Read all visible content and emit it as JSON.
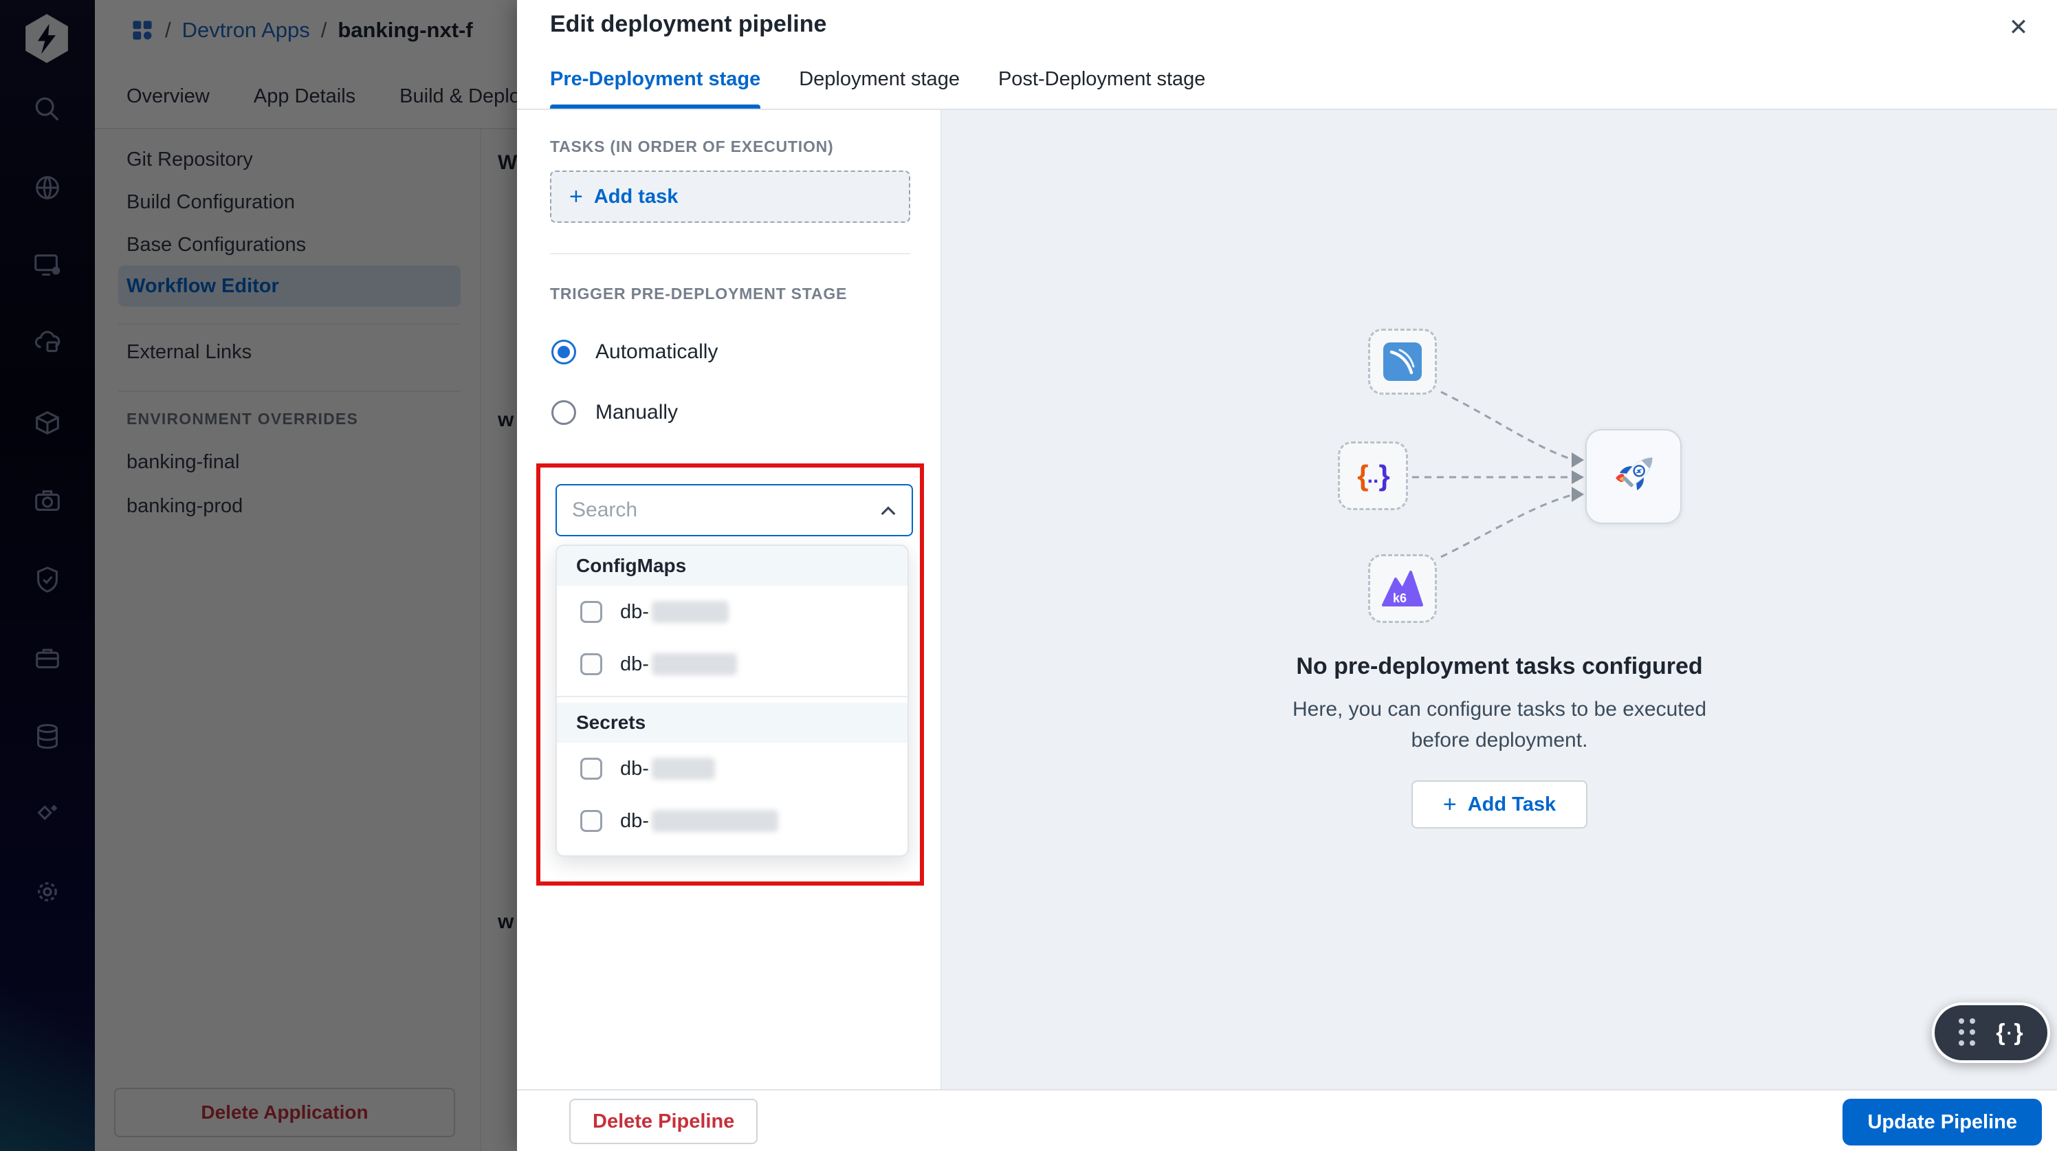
{
  "app": {
    "breadcrumb": {
      "sep": "/",
      "items": [
        "Devtron Apps",
        "banking-nxt-f"
      ]
    },
    "tabs": [
      "Overview",
      "App Details",
      "Build & Deploy"
    ],
    "sidebar": {
      "items": [
        "Git Repository",
        "Build Configuration",
        "Base Configurations",
        "Workflow Editor",
        "External Links"
      ],
      "active_item": "Workflow Editor",
      "section_label": "ENVIRONMENT OVERRIDES",
      "environments": [
        "banking-final",
        "banking-prod"
      ],
      "delete_button": "Delete Application"
    },
    "fragments": [
      "W",
      "w",
      "w"
    ],
    "rail_icons": [
      "devtron-logo",
      "search-icon",
      "globe-icon",
      "monitor-icon",
      "cloud-ci-icon",
      "package-icon",
      "camera-icon",
      "shield-check-icon",
      "briefcase-icon",
      "database-icon",
      "sparkle-icon",
      "gear-icon"
    ]
  },
  "modal": {
    "title": "Edit deployment pipeline",
    "close_icon": "✕",
    "tabs": [
      {
        "label": "Pre-Deployment stage",
        "active": true
      },
      {
        "label": "Deployment stage",
        "active": false
      },
      {
        "label": "Post-Deployment stage",
        "active": false
      }
    ],
    "tasks_section": {
      "label": "TASKS (IN ORDER OF EXECUTION)",
      "plus": "+",
      "add_task": "Add task"
    },
    "trigger_section": {
      "label": "TRIGGER PRE-DEPLOYMENT STAGE",
      "options": [
        {
          "label": "Automatically",
          "selected": true
        },
        {
          "label": "Manually",
          "selected": false
        }
      ]
    },
    "config_dropdown": {
      "search_placeholder": "Search",
      "groups": [
        {
          "label": "ConfigMaps",
          "items": [
            {
              "prefix": "db-",
              "redacted": true
            },
            {
              "prefix": "db-",
              "redacted": true
            }
          ]
        },
        {
          "label": "Secrets",
          "items": [
            {
              "prefix": "db-",
              "redacted": true
            },
            {
              "prefix": "db-",
              "redacted": true
            }
          ]
        }
      ]
    },
    "illustration": {
      "icons": [
        "swoosh-icon",
        "code-braces-icon",
        "k6-icon",
        "rocket-icon"
      ],
      "braces_left": "{",
      "braces_dots": "..",
      "braces_right": "}",
      "k6_label": "k6"
    },
    "empty_state": {
      "title": "No pre-deployment tasks configured",
      "line1": "Here, you can configure tasks to be executed",
      "line2": "before deployment.",
      "plus": "+",
      "add_task": "Add Task"
    },
    "footer": {
      "delete_button": "Delete Pipeline",
      "update_button": "Update Pipeline"
    },
    "floating_pill": {
      "braces_left": "{",
      "dot": "·",
      "braces_right": "}"
    }
  },
  "colors": {
    "accent": "#0066cc",
    "danger": "#c5303a",
    "annotation_red": "#e01212",
    "panel_bg": "#edf0f4",
    "pill_bg": "#303845"
  }
}
